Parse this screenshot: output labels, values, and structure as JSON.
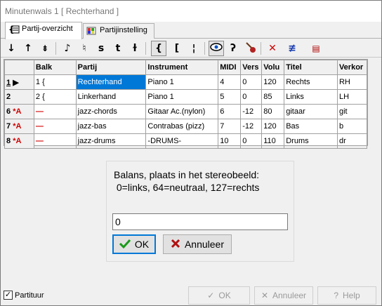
{
  "window": {
    "title": "Minutenwals   1   [ Rechterhand ]"
  },
  "tabs": [
    {
      "label": "Partij-overzicht",
      "active": true,
      "icon": "list-icon"
    },
    {
      "label": "Partijinstelling",
      "active": false,
      "icon": "palette-icon"
    }
  ],
  "toolbar": {
    "buttons": [
      {
        "name": "move-down-button",
        "glyph": "↓"
      },
      {
        "name": "move-up-button",
        "glyph": "↑"
      },
      {
        "name": "insert-staff-button",
        "glyph": "⇟"
      },
      {
        "name": "note-button",
        "glyph": "♪"
      },
      {
        "name": "flag-button",
        "glyph": "♮"
      },
      {
        "name": "s-button",
        "glyph": "s"
      },
      {
        "name": "t-button",
        "glyph": "t"
      },
      {
        "name": "k-button",
        "glyph": "ɫ"
      },
      {
        "name": "brace-button",
        "glyph": "{"
      },
      {
        "name": "bracket-button",
        "glyph": "["
      },
      {
        "name": "barline-button",
        "glyph": "¦"
      },
      {
        "name": "eye-button",
        "glyph": "👁"
      },
      {
        "name": "ear-button",
        "glyph": "ʔ"
      },
      {
        "name": "guitar-button",
        "glyph": "♩"
      },
      {
        "name": "delete-button",
        "glyph": "✕"
      },
      {
        "name": "strike-button",
        "glyph": "≢"
      },
      {
        "name": "dots-button",
        "glyph": "▤"
      }
    ]
  },
  "grid": {
    "columns": [
      "",
      "Balk",
      "Partij",
      "Instrument",
      "MIDI",
      "Vers",
      "Volu",
      "Titel",
      "Verkor"
    ],
    "rows": [
      {
        "num": "1",
        "prefix": "▶",
        "balk": "1  {",
        "partij": "Rechterhand",
        "instrument": "Piano 1",
        "midi": "4",
        "vers": "0",
        "volu": "120",
        "titel": "Rechts",
        "verkort": "RH"
      },
      {
        "num": "2",
        "prefix": "",
        "balk": "2  {",
        "partij": "Linkerhand",
        "instrument": "Piano 1",
        "midi": "5",
        "vers": "0",
        "volu": "85",
        "titel": "Links",
        "verkort": "LH"
      },
      {
        "num": "6",
        "prefix": "*A",
        "balk": "—",
        "partij": "jazz-chords",
        "instrument": "Gitaar Ac.(nylon)",
        "midi": "6",
        "vers": "-12",
        "volu": "80",
        "titel": "gitaar",
        "verkort": "git"
      },
      {
        "num": "7",
        "prefix": "*A",
        "balk": "—",
        "partij": "jazz-bas",
        "instrument": "Contrabas (pizz)",
        "midi": "7",
        "vers": "-12",
        "volu": "120",
        "titel": "Bas",
        "verkort": "b"
      },
      {
        "num": "8",
        "prefix": "*A",
        "balk": "—",
        "partij": "jazz-drums",
        "instrument": "-DRUMS-",
        "midi": "10",
        "vers": "0",
        "volu": "110",
        "titel": "Drums",
        "verkort": "dr"
      }
    ]
  },
  "dialog": {
    "message_line1": "Balans, plaats in het stereobeeld:",
    "message_line2": " 0=links, 64=neutraal, 127=rechts",
    "input_value": "0",
    "ok_label": "OK",
    "cancel_label": "Annuleer"
  },
  "footer": {
    "partituur_label": "Partituur",
    "partituur_checked": true,
    "ok_label": "OK",
    "cancel_label": "Annuleer",
    "help_label": "Help"
  }
}
